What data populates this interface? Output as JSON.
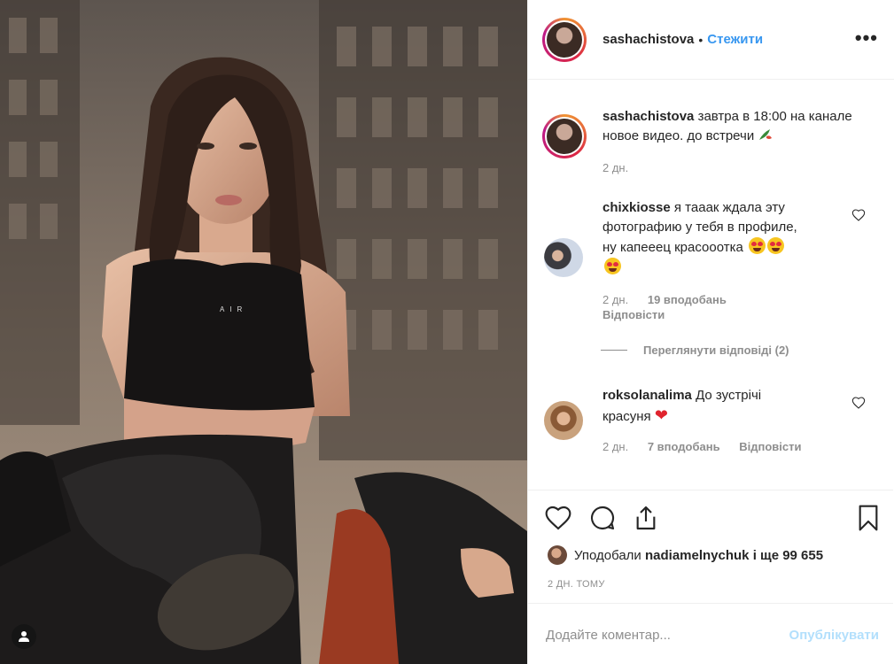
{
  "post": {
    "username": "sashachistova",
    "follow_label": "Стежити",
    "dot": "•",
    "more_label": "•••"
  },
  "caption": {
    "username": "sashachistova",
    "text": "завтра в 18:00 на каналe новое видео. до встречи",
    "age": "2 дн."
  },
  "comments": [
    {
      "username": "chixkiosse",
      "text_line1": "я тааак ждала эту",
      "text_line2": "фотографию у тебя в профиле,",
      "text_line3": "ну капееец красооотка",
      "age": "2 дн.",
      "likes": "19 вподобань",
      "reply": "Відповісти"
    },
    {
      "username": "roksolanalima",
      "text_line1": "До зустрічі",
      "text_line2": "красуня",
      "age": "2 дн.",
      "likes": "7 вподобань",
      "reply": "Відповісти"
    }
  ],
  "view_replies": "Переглянути відповіді (2)",
  "likes_bar": {
    "prefix": "Уподобали",
    "user": "nadiamelnychuk",
    "suffix": "і ще 99 655"
  },
  "timestamp": "2 ДН. ТОМУ",
  "comment_input": {
    "placeholder": "Додайте коментар...",
    "post_label": "Опублікувати"
  },
  "colors": {
    "link_blue": "#3897f0",
    "muted": "#8e8e8e",
    "post_disabled": "#b2dffc",
    "heart_red": "#e0242e"
  }
}
